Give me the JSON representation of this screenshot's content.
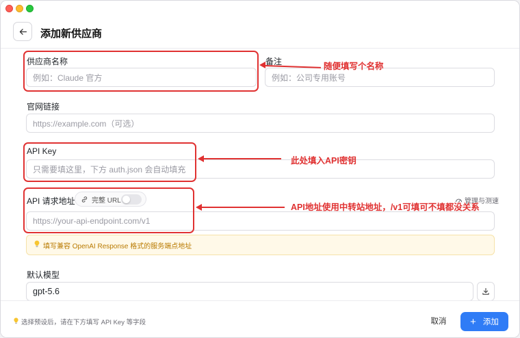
{
  "header": {
    "title": "添加新供应商"
  },
  "form": {
    "provider_name": {
      "label": "供应商名称",
      "placeholder": "例如：Claude 官方"
    },
    "notes": {
      "label": "备注",
      "placeholder": "例如：公司专用账号"
    },
    "website": {
      "label": "官网链接",
      "placeholder": "https://example.com（可选）"
    },
    "api_key": {
      "label": "API Key",
      "placeholder": "只需要填这里，下方 auth.json 会自动填充"
    },
    "api_endpoint": {
      "label": "API 请求地址",
      "full_url_toggle_label": "完整 URL",
      "full_url_enabled": false,
      "manage_label": "管理与测速",
      "placeholder": "https://your-api-endpoint.com/v1"
    },
    "endpoint_hint": "填写兼容 OpenAI Response 格式的服务端点地址",
    "default_model": {
      "label": "默认模型",
      "value": "gpt-5.6"
    }
  },
  "annotations": {
    "name_note": "随便填写个名称",
    "key_note": "此处填入API密钥",
    "endpoint_note": "API地址使用中转站地址，/v1可填可不填都没关系"
  },
  "footer": {
    "hint": "选择预设后，请在下方填写 API Key 等字段",
    "cancel_label": "取消",
    "add_label": "添加"
  },
  "colors": {
    "accent": "#2f7cf6",
    "annotation": "#e03131",
    "hint_text": "#b97a00",
    "hint_bg": "#fff9e8"
  },
  "icons": {
    "back": "arrow-left-icon",
    "link": "link-icon",
    "manage": "speed-test-icon",
    "bulb": "lightbulb-icon",
    "download": "download-icon",
    "plus": "plus-icon"
  }
}
